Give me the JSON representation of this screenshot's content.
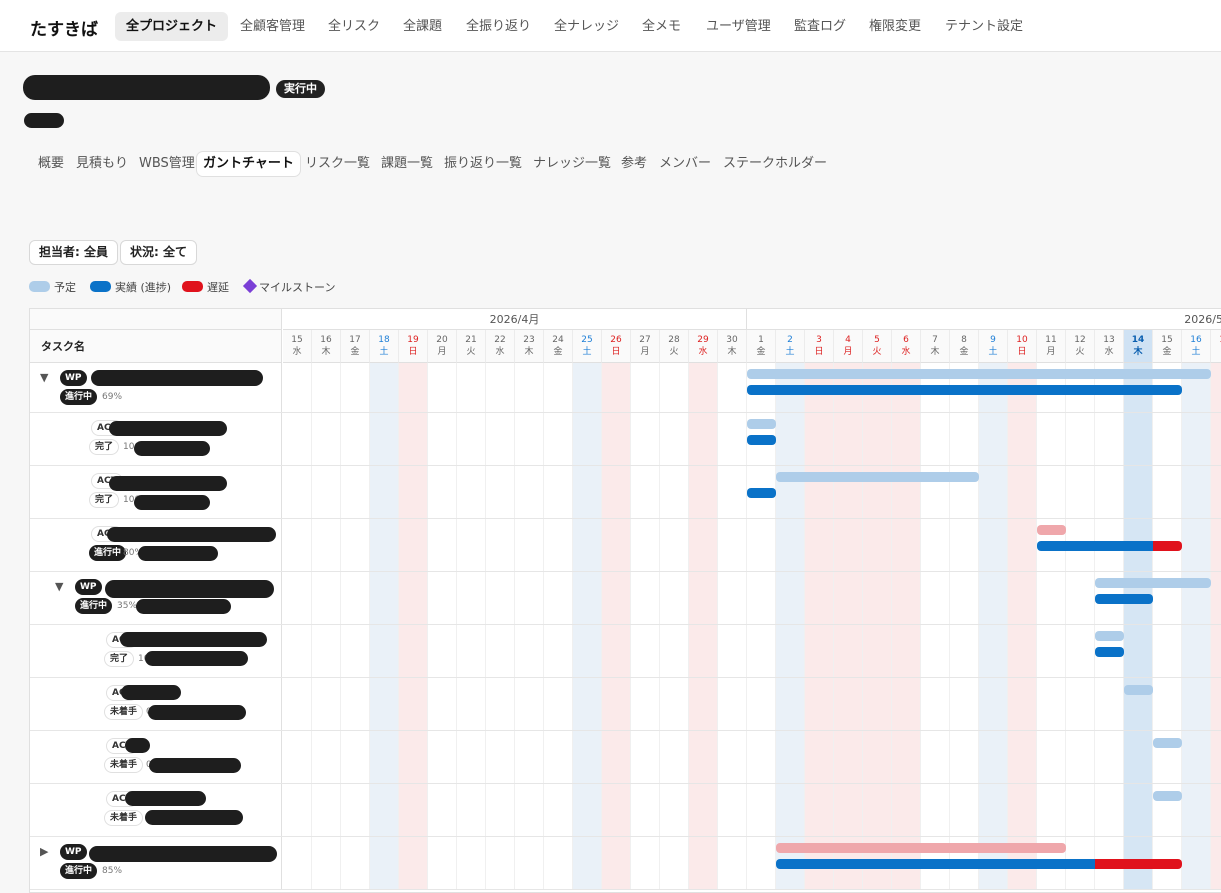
{
  "app": {
    "logo": "たすきば"
  },
  "nav": [
    {
      "label": "全プロジェクト",
      "active": true
    },
    {
      "label": "全顧客管理"
    },
    {
      "label": "全リスク"
    },
    {
      "label": "全課題"
    },
    {
      "label": "全振り返り"
    },
    {
      "label": "全ナレッジ"
    },
    {
      "label": "全メモ"
    },
    {
      "label": "ユーザ管理"
    },
    {
      "label": "監査ログ"
    },
    {
      "label": "権限変更"
    },
    {
      "label": "テナント設定"
    }
  ],
  "project": {
    "status": "実行中"
  },
  "subtabs": [
    {
      "label": "概要"
    },
    {
      "label": "見積もり"
    },
    {
      "label": "WBS管理"
    },
    {
      "label": "ガントチャート",
      "active": true
    },
    {
      "label": "リスク一覧"
    },
    {
      "label": "課題一覧"
    },
    {
      "label": "振り返り一覧"
    },
    {
      "label": "ナレッジ一覧"
    },
    {
      "label": "参考"
    },
    {
      "label": "メンバー"
    },
    {
      "label": "ステークホルダー"
    }
  ],
  "filters": {
    "assignee": "担当者: 全員",
    "status": "状況: 全て"
  },
  "legend": {
    "plan": "予定",
    "actual": "実績 (進捗)",
    "late": "遅延",
    "milestone": "マイルストーン",
    "colors": {
      "plan": "#aecde9",
      "actual": "#0a72c8",
      "late": "#e0121c",
      "milestone": "#7b3fd6"
    }
  },
  "gantt": {
    "task_header": "タスク名",
    "months": [
      {
        "label": "2026/4月"
      },
      {
        "label": "2026/5月"
      }
    ],
    "days": [
      {
        "d": "15",
        "w": "水"
      },
      {
        "d": "16",
        "w": "木"
      },
      {
        "d": "17",
        "w": "金"
      },
      {
        "d": "18",
        "w": "土",
        "t": "sat"
      },
      {
        "d": "19",
        "w": "日",
        "t": "sun"
      },
      {
        "d": "20",
        "w": "月"
      },
      {
        "d": "21",
        "w": "火"
      },
      {
        "d": "22",
        "w": "水"
      },
      {
        "d": "23",
        "w": "木"
      },
      {
        "d": "24",
        "w": "金"
      },
      {
        "d": "25",
        "w": "土",
        "t": "sat"
      },
      {
        "d": "26",
        "w": "日",
        "t": "sun"
      },
      {
        "d": "27",
        "w": "月"
      },
      {
        "d": "28",
        "w": "火"
      },
      {
        "d": "29",
        "w": "水",
        "t": "hol"
      },
      {
        "d": "30",
        "w": "木"
      },
      {
        "d": "1",
        "w": "金"
      },
      {
        "d": "2",
        "w": "土",
        "t": "sat"
      },
      {
        "d": "3",
        "w": "日",
        "t": "sun"
      },
      {
        "d": "4",
        "w": "月",
        "t": "hol"
      },
      {
        "d": "5",
        "w": "火",
        "t": "hol"
      },
      {
        "d": "6",
        "w": "水",
        "t": "hol"
      },
      {
        "d": "7",
        "w": "木"
      },
      {
        "d": "8",
        "w": "金"
      },
      {
        "d": "9",
        "w": "土",
        "t": "sat"
      },
      {
        "d": "10",
        "w": "日",
        "t": "sun"
      },
      {
        "d": "11",
        "w": "月"
      },
      {
        "d": "12",
        "w": "火"
      },
      {
        "d": "13",
        "w": "水"
      },
      {
        "d": "14",
        "w": "木",
        "t": "today"
      },
      {
        "d": "15",
        "w": "金"
      },
      {
        "d": "16",
        "w": "土",
        "t": "sat"
      },
      {
        "d": "17",
        "w": "日",
        "t": "sun"
      }
    ],
    "rows": [
      {
        "type": "WP",
        "level": 0,
        "toggle": "▼",
        "status": "進行中",
        "progress": "69%",
        "plan": [
          16,
          32
        ],
        "actual": [
          16,
          31
        ],
        "actual_late_from": null
      },
      {
        "type": "ACT",
        "level": 1,
        "status": "完了",
        "progress": "100%",
        "plan": [
          16,
          17
        ],
        "actual": [
          16,
          17
        ]
      },
      {
        "type": "ACT",
        "level": 1,
        "status": "完了",
        "progress": "100%",
        "plan": [
          17,
          24
        ],
        "actual": [
          16,
          17
        ]
      },
      {
        "type": "ACT",
        "level": 1,
        "status": "進行中",
        "progress": "80%",
        "plan": [
          26,
          27
        ],
        "actual": [
          26,
          30
        ],
        "late_to": 31,
        "plan_late": true
      },
      {
        "type": "WP",
        "level": 1,
        "toggle": "▼",
        "status": "進行中",
        "progress": "35%",
        "plan": [
          28,
          32
        ],
        "actual": [
          28,
          30
        ]
      },
      {
        "type": "ACT",
        "level": 2,
        "status": "完了",
        "progress": "100%",
        "plan": [
          28,
          29
        ],
        "actual": [
          28,
          29
        ]
      },
      {
        "type": "ACT",
        "level": 2,
        "status": "未着手",
        "progress": "0%",
        "plan": [
          29,
          30
        ]
      },
      {
        "type": "ACT",
        "level": 2,
        "status": "未着手",
        "progress": "0%",
        "plan": [
          30,
          31
        ]
      },
      {
        "type": "ACT",
        "level": 2,
        "status": "未着手",
        "progress": "0%",
        "plan": [
          30,
          31
        ]
      },
      {
        "type": "WP",
        "level": 0,
        "toggle": "▶",
        "status": "進行中",
        "progress": "85%",
        "plan": [
          17,
          27
        ],
        "actual": [
          17,
          28
        ],
        "late_to": 31,
        "plan_late": true
      }
    ]
  }
}
